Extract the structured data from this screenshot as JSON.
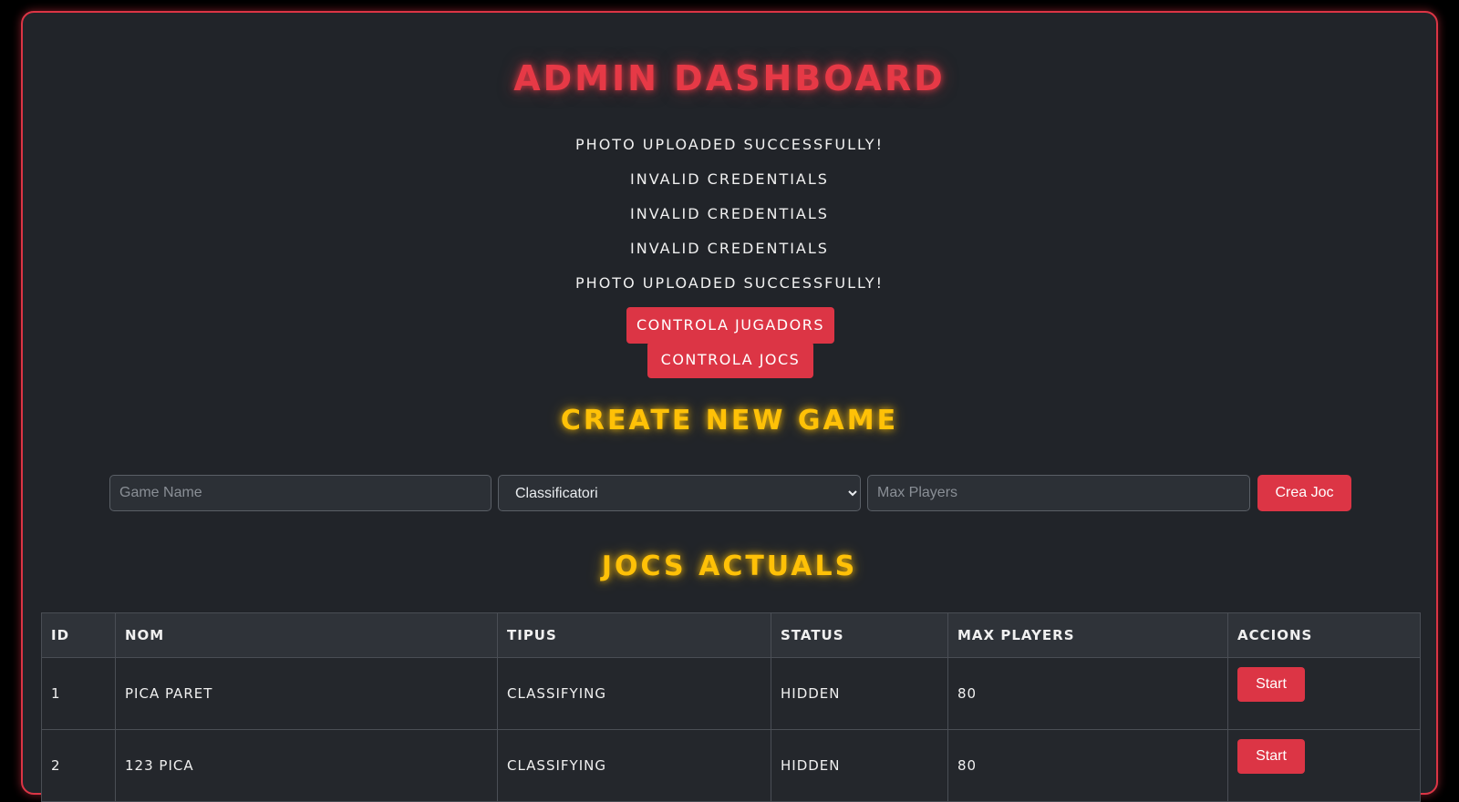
{
  "page": {
    "title": "Admin Dashboard"
  },
  "messages": [
    "Photo uploaded successfully!",
    "Invalid credentials",
    "Invalid credentials",
    "Invalid credentials",
    "Photo uploaded successfully!"
  ],
  "nav": {
    "players_button": "Controla Jugadors",
    "games_button": "Controla Jocs"
  },
  "create_game": {
    "title": "Create New Game",
    "name_placeholder": "Game Name",
    "type_selected": "Classificatori",
    "max_placeholder": "Max Players",
    "submit_label": "Crea Joc"
  },
  "current_games": {
    "title": "Jocs Actuals",
    "headers": [
      "ID",
      "Nom",
      "Tipus",
      "Status",
      "Max Players",
      "Accions"
    ],
    "rows": [
      {
        "id": "1",
        "nom": "Pica Paret",
        "tipus": "Classifying",
        "status": "Hidden",
        "max": "80",
        "action": "Start"
      },
      {
        "id": "2",
        "nom": "123 Pica",
        "tipus": "Classifying",
        "status": "Hidden",
        "max": "80",
        "action": "Start"
      }
    ]
  },
  "colors": {
    "accent_red": "#dc3545",
    "accent_yellow": "#ffc107",
    "panel_bg": "#212429"
  }
}
